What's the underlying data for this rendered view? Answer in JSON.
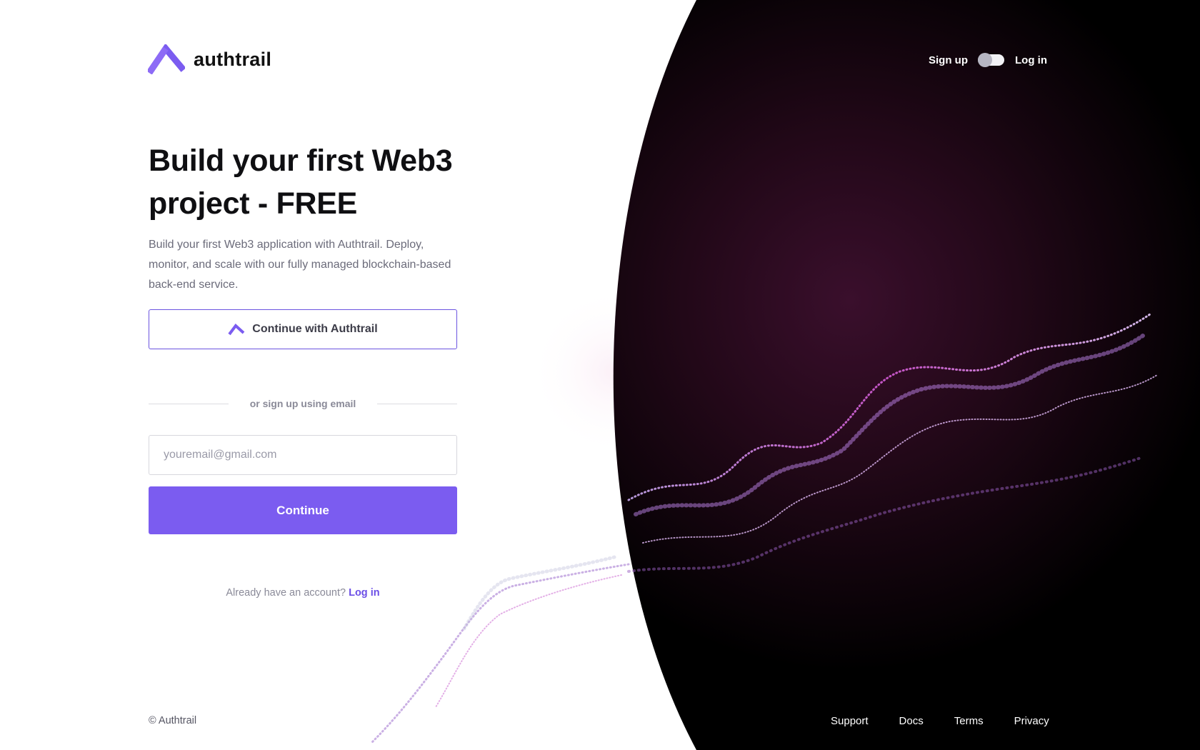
{
  "brand": {
    "name": "authtrail",
    "accent": "#7b5cf0"
  },
  "topnav": {
    "signup_label": "Sign up",
    "login_label": "Log in"
  },
  "main": {
    "headline_line1": "Build your first Web3",
    "headline_line2": "project - FREE",
    "subtitle": "Build your first Web3 application with Authtrail. Deploy, monitor, and scale with our fully managed blockchain-based back-end service.",
    "authtrail_button_label": "Continue with Authtrail",
    "divider_text": "or sign up using email",
    "email_placeholder": "youremail@gmail.com",
    "email_value": "",
    "continue_label": "Continue",
    "have_account_text": "Already have an account?",
    "login_link_label": "Log in"
  },
  "footer": {
    "copyright": "© Authtrail",
    "links": [
      "Support",
      "Docs",
      "Terms",
      "Privacy"
    ]
  },
  "icons": {
    "logo": "authtrail-logo-icon",
    "button": "authtrail-logo-icon"
  }
}
